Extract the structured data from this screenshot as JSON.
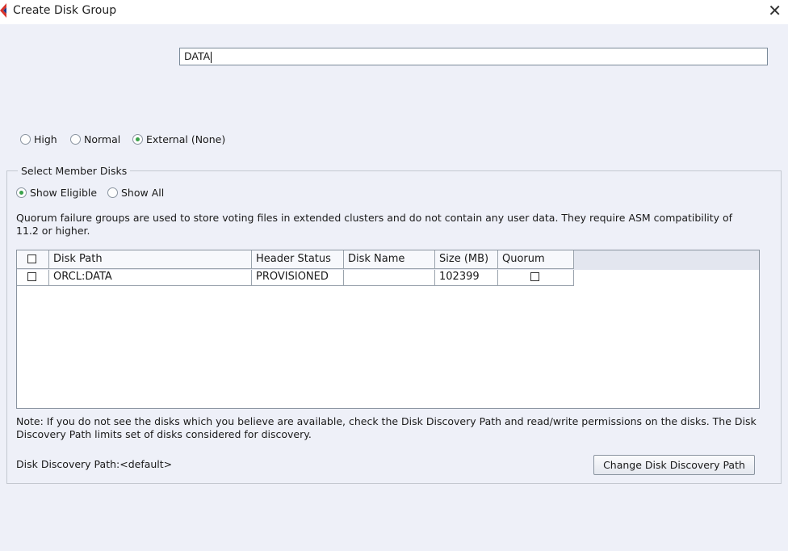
{
  "window": {
    "title": "Create Disk Group"
  },
  "disk_group_name": {
    "value": "DATA"
  },
  "redundancy": {
    "options": [
      "High",
      "Normal",
      "External (None)"
    ],
    "selected": "External (None)"
  },
  "member_disks": {
    "legend": "Select Member Disks",
    "filter_options": [
      "Show Eligible",
      "Show All"
    ],
    "filter_selected": "Show Eligible",
    "info": "Quorum failure groups are used to store voting files in extended clusters and do not contain any user data. They require ASM compatibility of 11.2 or higher.",
    "columns": [
      "Disk Path",
      "Header Status",
      "Disk Name",
      "Size (MB)",
      "Quorum"
    ],
    "rows": [
      {
        "selected": false,
        "disk_path": "ORCL:DATA",
        "header_status": "PROVISIONED",
        "disk_name": "",
        "size_mb": "102399",
        "quorum": false
      }
    ],
    "note": "Note: If you do not see the disks which you believe are available, check the Disk Discovery Path and read/write permissions on the disks. The Disk Discovery Path limits set of disks considered for discovery.",
    "discovery_path_label": "Disk Discovery Path:<default>",
    "change_button_label": "Change Disk Discovery Path"
  },
  "colors": {
    "radio_selected": "#3aa24a",
    "app_icon": "#d9342b",
    "background": "#eef0f8"
  }
}
